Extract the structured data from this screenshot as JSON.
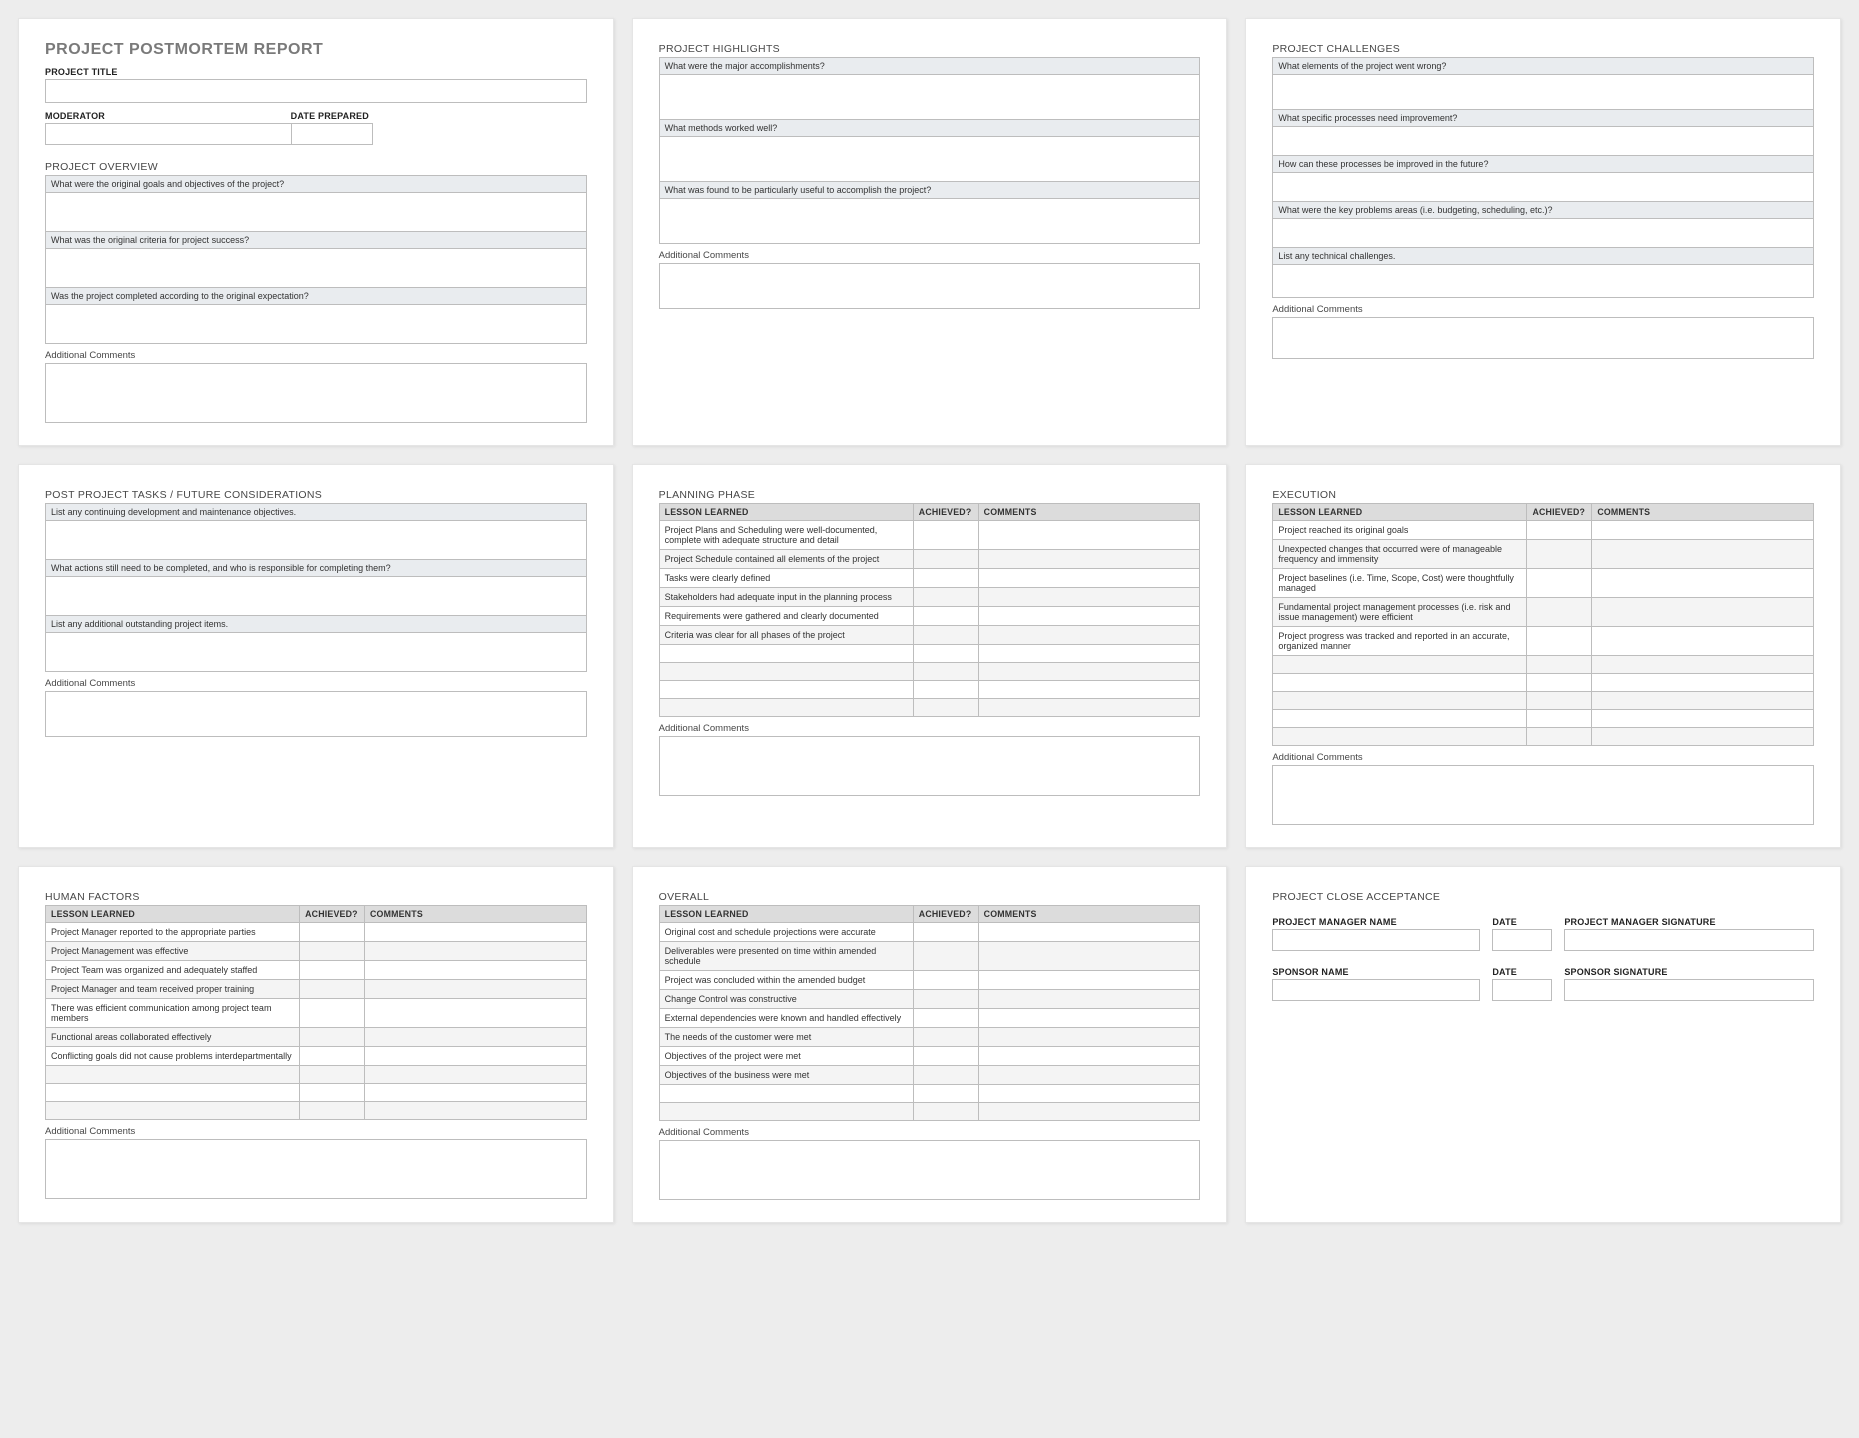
{
  "report_title": "PROJECT POSTMORTEM REPORT",
  "panels": {
    "postmortem": {
      "project_title_label": "PROJECT TITLE",
      "moderator_label": "MODERATOR",
      "date_prepared_label": "DATE PREPARED",
      "overview_title": "PROJECT OVERVIEW",
      "q1": "What were the original goals and objectives of the project?",
      "q2": "What was the original criteria for project success?",
      "q3": "Was the project completed according to the original expectation?",
      "additional": "Additional Comments"
    },
    "highlights": {
      "title": "PROJECT HIGHLIGHTS",
      "q1": "What were the major accomplishments?",
      "q2": "What methods worked well?",
      "q3": "What was found to be particularly useful to accomplish the project?",
      "additional": "Additional Comments"
    },
    "challenges": {
      "title": "PROJECT CHALLENGES",
      "q1": "What elements of the project went wrong?",
      "q2": "What specific processes need improvement?",
      "q3": "How can these processes be improved in the future?",
      "q4": "What were the key problems areas (i.e. budgeting, scheduling, etc.)?",
      "q5": "List any technical challenges.",
      "additional": "Additional Comments"
    },
    "postproject": {
      "title": "POST PROJECT TASKS / FUTURE CONSIDERATIONS",
      "q1": "List any continuing development and maintenance objectives.",
      "q2": "What actions still need to be completed, and who is responsible for completing them?",
      "q3": "List any additional outstanding project items.",
      "additional": "Additional Comments"
    },
    "planning": {
      "title": "PLANNING PHASE",
      "col_lesson": "LESSON LEARNED",
      "col_achieved": "ACHIEVED?",
      "col_comments": "COMMENTS",
      "rows": [
        "Project Plans and Scheduling were well-documented, complete with adequate structure and detail",
        "Project Schedule contained all elements of the project",
        "Tasks were clearly defined",
        "Stakeholders had adequate input in the planning process",
        "Requirements were gathered and clearly documented",
        "Criteria was clear for all phases of the project",
        "",
        "",
        "",
        ""
      ],
      "additional": "Additional Comments"
    },
    "execution": {
      "title": "EXECUTION",
      "col_lesson": "LESSON LEARNED",
      "col_achieved": "ACHIEVED?",
      "col_comments": "COMMENTS",
      "rows": [
        "Project reached its original goals",
        "Unexpected changes that occurred were of manageable frequency and immensity",
        "Project baselines (i.e. Time, Scope, Cost) were thoughtfully managed",
        "Fundamental project management processes (i.e. risk and issue management) were efficient",
        "Project progress was tracked and reported in an accurate, organized manner",
        "",
        "",
        "",
        "",
        ""
      ],
      "additional": "Additional Comments"
    },
    "human": {
      "title": "HUMAN FACTORS",
      "col_lesson": "LESSON LEARNED",
      "col_achieved": "ACHIEVED?",
      "col_comments": "COMMENTS",
      "rows": [
        "Project Manager reported to the appropriate parties",
        "Project Management was effective",
        "Project Team was organized and adequately staffed",
        "Project Manager and team received proper training",
        "There was efficient communication among project team members",
        "Functional areas collaborated effectively",
        "Conflicting goals did not cause problems interdepartmentally",
        "",
        "",
        ""
      ],
      "additional": "Additional Comments"
    },
    "overall": {
      "title": "OVERALL",
      "col_lesson": "LESSON LEARNED",
      "col_achieved": "ACHIEVED?",
      "col_comments": "COMMENTS",
      "rows": [
        "Original cost and schedule projections were accurate",
        "Deliverables were presented on time within amended schedule",
        "Project was concluded within the amended budget",
        "Change Control was constructive",
        "External dependencies were known and handled effectively",
        "The needs of the customer were met",
        "Objectives of the project were met",
        "Objectives of the business were met",
        "",
        ""
      ],
      "additional": "Additional Comments"
    },
    "closeout": {
      "title": "PROJECT CLOSE ACCEPTANCE",
      "pm_name": "PROJECT MANAGER NAME",
      "date": "DATE",
      "pm_sig": "PROJECT MANAGER SIGNATURE",
      "sponsor_name": "SPONSOR NAME",
      "sponsor_sig": "SPONSOR SIGNATURE"
    }
  }
}
